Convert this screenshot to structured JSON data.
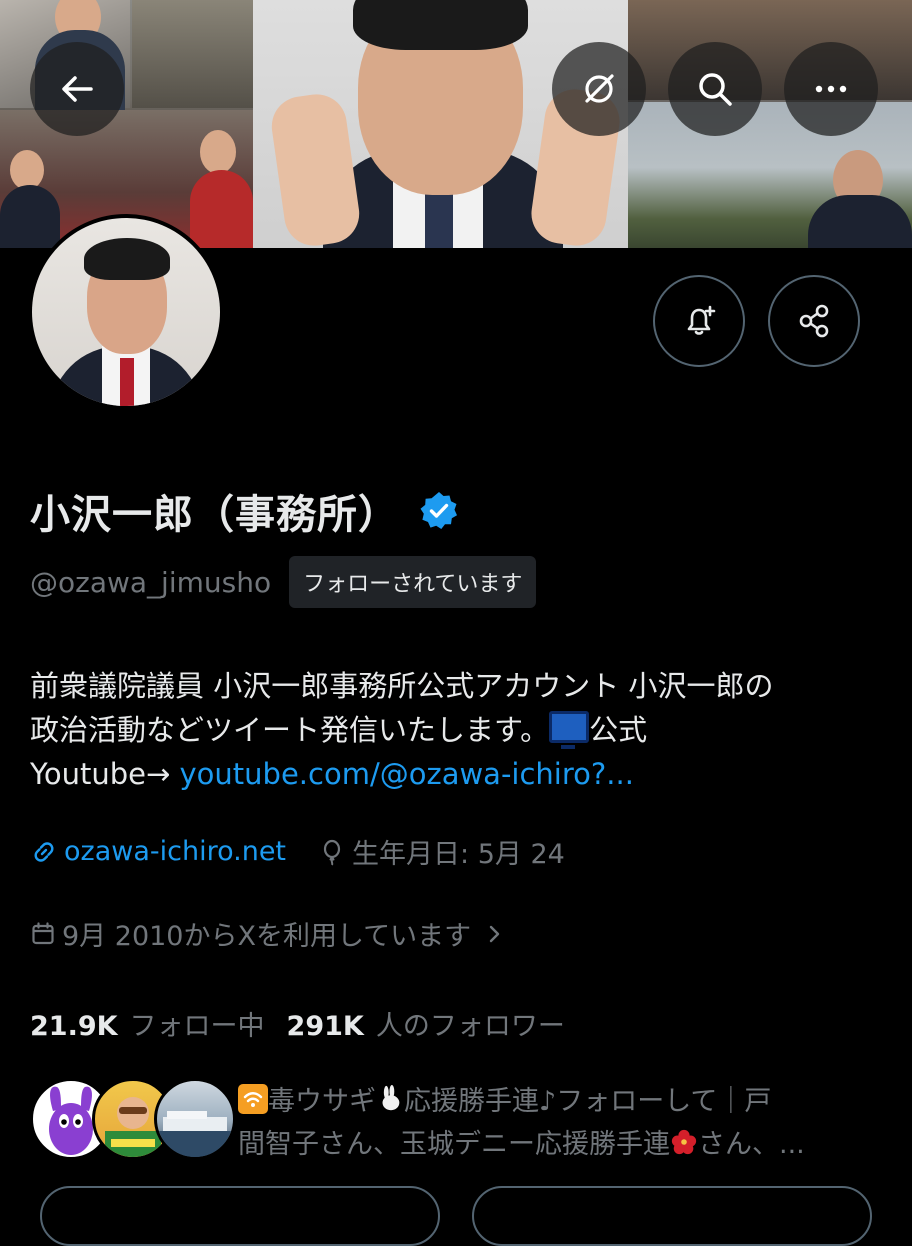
{
  "header": {
    "back_icon": "arrow-left-icon",
    "grok_icon": "grok-icon",
    "search_icon": "search-icon",
    "more_icon": "more-horizontal-icon"
  },
  "actions": {
    "notify_icon": "bell-plus-icon",
    "share_icon": "share-icon"
  },
  "profile": {
    "name": "小沢一郎（事務所）",
    "verified": true,
    "handle": "@ozawa_jimusho",
    "follows_you": "フォローされています",
    "bio_line1": "前衆議院議員 小沢一郎事務所公式アカウント 小沢一郎の",
    "bio_line2": "政治活動などツイート発信いたします。",
    "bio_line2_after": "公式",
    "bio_line3": "Youtube→ ",
    "bio_link": "youtube.com/@ozawa-ichiro?...",
    "website": "ozawa-ichiro.net",
    "birthday": "生年月日: 5月 24",
    "joined": "9月 2010からXを利用しています",
    "following_count": "21.9K",
    "following_label": "フォロー中",
    "followers_count": "291K",
    "followers_label": "人のフォロワー",
    "followed_by_line1": "毒ウサギ",
    "followed_by_line1b": "応援勝手連♪フォローして｜戸",
    "followed_by_line2": "間智子さん、玉城デニー応援勝手連",
    "followed_by_line2b": "さん、..."
  },
  "colors": {
    "background": "#000000",
    "text_primary": "#e7e9ea",
    "text_secondary": "#71767b",
    "link": "#1d9bf0",
    "border": "#536471",
    "verified": "#1d9bf0"
  }
}
